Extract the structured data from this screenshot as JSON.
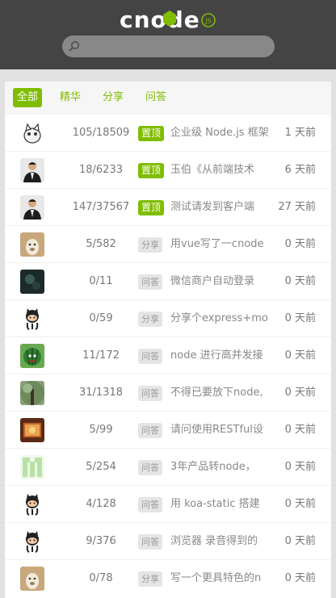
{
  "header": {
    "logo_text": "cnode",
    "logo_badge": "JS",
    "search_placeholder": ""
  },
  "tabs": [
    {
      "label": "全部",
      "active": true
    },
    {
      "label": "精华",
      "active": false
    },
    {
      "label": "分享",
      "active": false
    },
    {
      "label": "问答",
      "active": false
    }
  ],
  "colors": {
    "accent": "#80bd01",
    "topbar": "#444444"
  },
  "topics": [
    {
      "avatar": "cat-avatar",
      "count": "105/18509",
      "tag": "置顶",
      "tag_type": "top",
      "title": "企业级 Node.js 框架",
      "time": "1 天前"
    },
    {
      "avatar": "man-avatar",
      "count": "18/6233",
      "tag": "置顶",
      "tag_type": "top",
      "title": "玉伯《从前端技术",
      "time": "6 天前"
    },
    {
      "avatar": "man-avatar",
      "count": "147/37567",
      "tag": "置顶",
      "tag_type": "top",
      "title": "测试请发到客户端",
      "time": "27 天前"
    },
    {
      "avatar": "alpaca-avatar",
      "count": "5/582",
      "tag": "分享",
      "tag_type": "plain",
      "title": "用vue写了一cnode",
      "time": "0 天前"
    },
    {
      "avatar": "dark-avatar",
      "count": "0/11",
      "tag": "问答",
      "tag_type": "plain",
      "title": "微信商户自动登录",
      "time": "0 天前"
    },
    {
      "avatar": "octocat-avatar",
      "count": "0/59",
      "tag": "分享",
      "tag_type": "plain",
      "title": "分享个express+mo",
      "time": "0 天前"
    },
    {
      "avatar": "melon-avatar",
      "count": "11/172",
      "tag": "问答",
      "tag_type": "plain",
      "title": "node 进行高并发接",
      "time": "0 天前"
    },
    {
      "avatar": "tree-avatar",
      "count": "31/1318",
      "tag": "问答",
      "tag_type": "plain",
      "title": "不得已要放下node,",
      "time": "0 天前"
    },
    {
      "avatar": "book-avatar",
      "count": "5/99",
      "tag": "问答",
      "tag_type": "plain",
      "title": "请问使用RESTful设",
      "time": "0 天前"
    },
    {
      "avatar": "pattern-avatar",
      "count": "5/254",
      "tag": "问答",
      "tag_type": "plain",
      "title": "3年产品转node，",
      "time": "0 天前"
    },
    {
      "avatar": "octocat-avatar",
      "count": "4/128",
      "tag": "问答",
      "tag_type": "plain",
      "title": "用 koa-static 搭建",
      "time": "0 天前"
    },
    {
      "avatar": "octocat-avatar",
      "count": "9/376",
      "tag": "问答",
      "tag_type": "plain",
      "title": "浏览器 录音得到的",
      "time": "0 天前"
    },
    {
      "avatar": "alpaca-avatar",
      "count": "0/78",
      "tag": "分享",
      "tag_type": "plain",
      "title": "写一个更具特色的n",
      "time": "0 天前"
    }
  ]
}
